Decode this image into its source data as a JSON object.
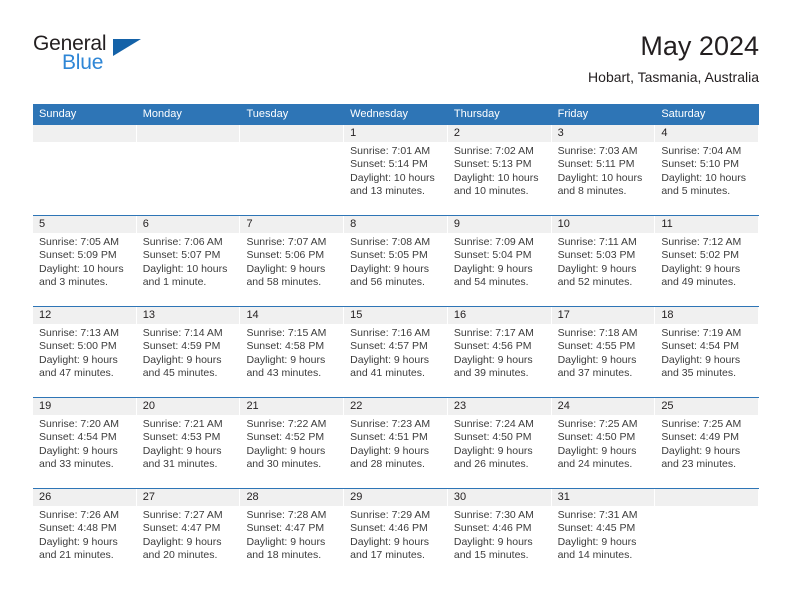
{
  "brand": {
    "name_part1": "General",
    "name_part2": "Blue",
    "triangle_color": "#1462A8",
    "blue_color": "#2E86D6"
  },
  "header": {
    "month_title": "May 2024",
    "location": "Hobart, Tasmania, Australia"
  },
  "theme": {
    "header_blue": "#2E75B6",
    "day_band_gray": "#F0F0F0",
    "text_color": "#231F20"
  },
  "weekdays": [
    "Sunday",
    "Monday",
    "Tuesday",
    "Wednesday",
    "Thursday",
    "Friday",
    "Saturday"
  ],
  "weeks": [
    [
      {
        "day": "",
        "lines": []
      },
      {
        "day": "",
        "lines": []
      },
      {
        "day": "",
        "lines": []
      },
      {
        "day": "1",
        "lines": [
          "Sunrise: 7:01 AM",
          "Sunset: 5:14 PM",
          "Daylight: 10 hours",
          "and 13 minutes."
        ]
      },
      {
        "day": "2",
        "lines": [
          "Sunrise: 7:02 AM",
          "Sunset: 5:13 PM",
          "Daylight: 10 hours",
          "and 10 minutes."
        ]
      },
      {
        "day": "3",
        "lines": [
          "Sunrise: 7:03 AM",
          "Sunset: 5:11 PM",
          "Daylight: 10 hours",
          "and 8 minutes."
        ]
      },
      {
        "day": "4",
        "lines": [
          "Sunrise: 7:04 AM",
          "Sunset: 5:10 PM",
          "Daylight: 10 hours",
          "and 5 minutes."
        ]
      }
    ],
    [
      {
        "day": "5",
        "lines": [
          "Sunrise: 7:05 AM",
          "Sunset: 5:09 PM",
          "Daylight: 10 hours",
          "and 3 minutes."
        ]
      },
      {
        "day": "6",
        "lines": [
          "Sunrise: 7:06 AM",
          "Sunset: 5:07 PM",
          "Daylight: 10 hours",
          "and 1 minute."
        ]
      },
      {
        "day": "7",
        "lines": [
          "Sunrise: 7:07 AM",
          "Sunset: 5:06 PM",
          "Daylight: 9 hours",
          "and 58 minutes."
        ]
      },
      {
        "day": "8",
        "lines": [
          "Sunrise: 7:08 AM",
          "Sunset: 5:05 PM",
          "Daylight: 9 hours",
          "and 56 minutes."
        ]
      },
      {
        "day": "9",
        "lines": [
          "Sunrise: 7:09 AM",
          "Sunset: 5:04 PM",
          "Daylight: 9 hours",
          "and 54 minutes."
        ]
      },
      {
        "day": "10",
        "lines": [
          "Sunrise: 7:11 AM",
          "Sunset: 5:03 PM",
          "Daylight: 9 hours",
          "and 52 minutes."
        ]
      },
      {
        "day": "11",
        "lines": [
          "Sunrise: 7:12 AM",
          "Sunset: 5:02 PM",
          "Daylight: 9 hours",
          "and 49 minutes."
        ]
      }
    ],
    [
      {
        "day": "12",
        "lines": [
          "Sunrise: 7:13 AM",
          "Sunset: 5:00 PM",
          "Daylight: 9 hours",
          "and 47 minutes."
        ]
      },
      {
        "day": "13",
        "lines": [
          "Sunrise: 7:14 AM",
          "Sunset: 4:59 PM",
          "Daylight: 9 hours",
          "and 45 minutes."
        ]
      },
      {
        "day": "14",
        "lines": [
          "Sunrise: 7:15 AM",
          "Sunset: 4:58 PM",
          "Daylight: 9 hours",
          "and 43 minutes."
        ]
      },
      {
        "day": "15",
        "lines": [
          "Sunrise: 7:16 AM",
          "Sunset: 4:57 PM",
          "Daylight: 9 hours",
          "and 41 minutes."
        ]
      },
      {
        "day": "16",
        "lines": [
          "Sunrise: 7:17 AM",
          "Sunset: 4:56 PM",
          "Daylight: 9 hours",
          "and 39 minutes."
        ]
      },
      {
        "day": "17",
        "lines": [
          "Sunrise: 7:18 AM",
          "Sunset: 4:55 PM",
          "Daylight: 9 hours",
          "and 37 minutes."
        ]
      },
      {
        "day": "18",
        "lines": [
          "Sunrise: 7:19 AM",
          "Sunset: 4:54 PM",
          "Daylight: 9 hours",
          "and 35 minutes."
        ]
      }
    ],
    [
      {
        "day": "19",
        "lines": [
          "Sunrise: 7:20 AM",
          "Sunset: 4:54 PM",
          "Daylight: 9 hours",
          "and 33 minutes."
        ]
      },
      {
        "day": "20",
        "lines": [
          "Sunrise: 7:21 AM",
          "Sunset: 4:53 PM",
          "Daylight: 9 hours",
          "and 31 minutes."
        ]
      },
      {
        "day": "21",
        "lines": [
          "Sunrise: 7:22 AM",
          "Sunset: 4:52 PM",
          "Daylight: 9 hours",
          "and 30 minutes."
        ]
      },
      {
        "day": "22",
        "lines": [
          "Sunrise: 7:23 AM",
          "Sunset: 4:51 PM",
          "Daylight: 9 hours",
          "and 28 minutes."
        ]
      },
      {
        "day": "23",
        "lines": [
          "Sunrise: 7:24 AM",
          "Sunset: 4:50 PM",
          "Daylight: 9 hours",
          "and 26 minutes."
        ]
      },
      {
        "day": "24",
        "lines": [
          "Sunrise: 7:25 AM",
          "Sunset: 4:50 PM",
          "Daylight: 9 hours",
          "and 24 minutes."
        ]
      },
      {
        "day": "25",
        "lines": [
          "Sunrise: 7:25 AM",
          "Sunset: 4:49 PM",
          "Daylight: 9 hours",
          "and 23 minutes."
        ]
      }
    ],
    [
      {
        "day": "26",
        "lines": [
          "Sunrise: 7:26 AM",
          "Sunset: 4:48 PM",
          "Daylight: 9 hours",
          "and 21 minutes."
        ]
      },
      {
        "day": "27",
        "lines": [
          "Sunrise: 7:27 AM",
          "Sunset: 4:47 PM",
          "Daylight: 9 hours",
          "and 20 minutes."
        ]
      },
      {
        "day": "28",
        "lines": [
          "Sunrise: 7:28 AM",
          "Sunset: 4:47 PM",
          "Daylight: 9 hours",
          "and 18 minutes."
        ]
      },
      {
        "day": "29",
        "lines": [
          "Sunrise: 7:29 AM",
          "Sunset: 4:46 PM",
          "Daylight: 9 hours",
          "and 17 minutes."
        ]
      },
      {
        "day": "30",
        "lines": [
          "Sunrise: 7:30 AM",
          "Sunset: 4:46 PM",
          "Daylight: 9 hours",
          "and 15 minutes."
        ]
      },
      {
        "day": "31",
        "lines": [
          "Sunrise: 7:31 AM",
          "Sunset: 4:45 PM",
          "Daylight: 9 hours",
          "and 14 minutes."
        ]
      },
      {
        "day": "",
        "lines": []
      }
    ]
  ]
}
